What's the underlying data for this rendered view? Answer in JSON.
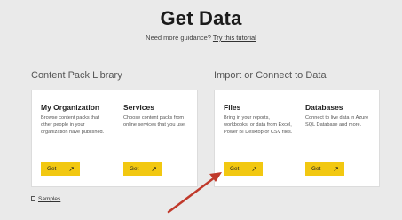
{
  "header": {
    "title": "Get Data",
    "guidance_text": "Need more guidance?",
    "guidance_link": "Try this tutorial"
  },
  "sections": {
    "content_pack": "Content Pack Library",
    "import_connect": "Import or Connect to Data"
  },
  "cards": [
    {
      "title": "My Organization",
      "desc": "Browse content packs that other people in your organization have published.",
      "button": "Get",
      "icon": "arrow-up-right-icon"
    },
    {
      "title": "Services",
      "desc": "Choose content packs from online services that you use.",
      "button": "Get",
      "icon": "arrow-up-right-icon"
    },
    {
      "title": "Files",
      "desc": "Bring in your reports, workbooks, or data from Excel, Power BI Desktop or CSV files.",
      "button": "Get",
      "icon": "arrow-up-right-icon"
    },
    {
      "title": "Databases",
      "desc": "Connect to live data in Azure SQL Database and more.",
      "button": "Get",
      "icon": "arrow-up-right-icon"
    }
  ],
  "footer": {
    "samples": "Samples"
  },
  "colors": {
    "background": "#eaeaea",
    "card": "#ffffff",
    "button": "#f2c811",
    "annotation_arrow": "#c0392b"
  }
}
